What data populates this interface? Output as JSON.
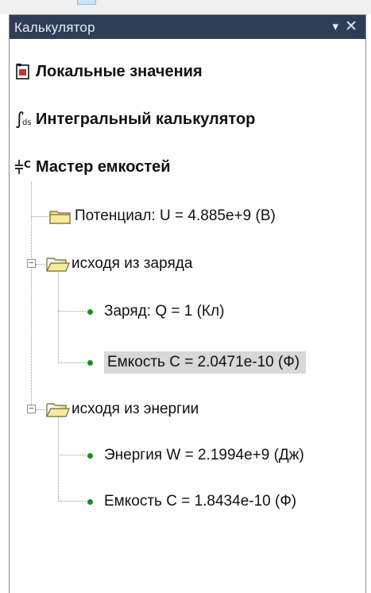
{
  "panel": {
    "title": "Калькулятор",
    "buttons": {
      "dropdown": "▾",
      "close": "✕"
    }
  },
  "main_items": [
    {
      "label": "Локальные значения",
      "icon": "local-values-icon"
    },
    {
      "label": "Интегральный калькулятор",
      "icon": "integral-calculator-icon"
    },
    {
      "label": "Мастер емкостей",
      "icon": "capacitor-wizard-icon"
    }
  ],
  "tree": {
    "potential": "Потенциал: U = 4.885e+9 (В)",
    "from_charge": {
      "label": "исходя из заряда",
      "items": [
        {
          "label": "Заряд: Q = 1 (Кл)"
        },
        {
          "label": "Емкость C = 2.0471e-10 (Ф)",
          "selected": true
        }
      ]
    },
    "from_energy": {
      "label": "исходя из энергии",
      "items": [
        {
          "label": "Энергия W = 2.1994e+9 (Дж)"
        },
        {
          "label": "Емкость C = 1.8434e-10 (Ф)"
        }
      ]
    },
    "expander_symbol": "−"
  },
  "colors": {
    "titlebar": "#2f3e58",
    "bullet": "#189018",
    "selection": "#d8d8d8"
  }
}
